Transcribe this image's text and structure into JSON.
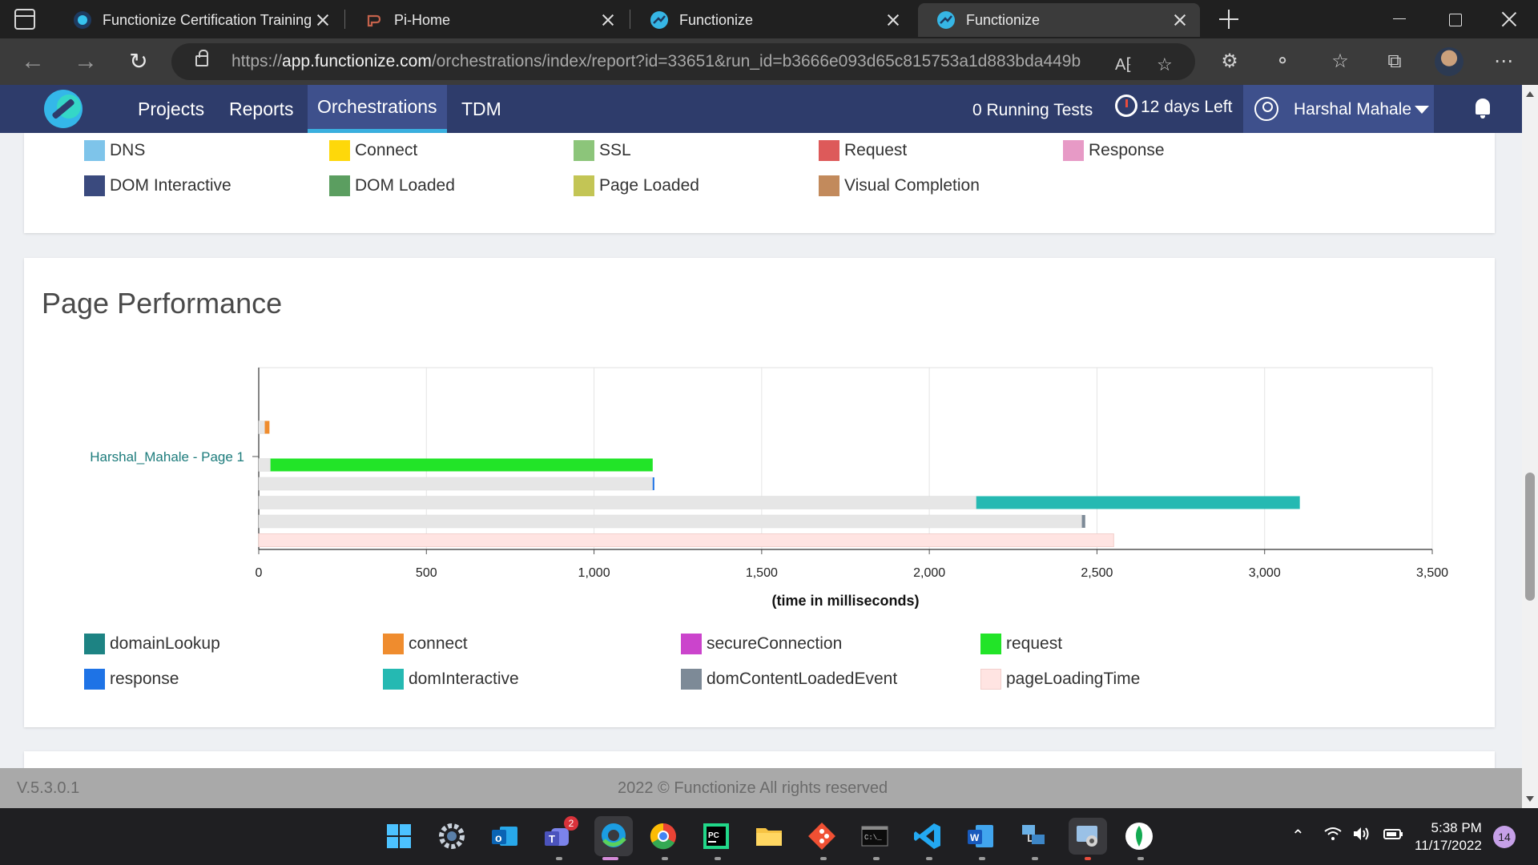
{
  "browser": {
    "tabs": [
      {
        "title": "Functionize Certification Training",
        "favicon": "functionize-icon",
        "active": false
      },
      {
        "title": "Pi-Home",
        "favicon": "pi-home-icon",
        "active": false
      },
      {
        "title": "Functionize",
        "favicon": "functionize-icon",
        "active": false
      },
      {
        "title": "Functionize",
        "favicon": "functionize-icon",
        "active": true
      }
    ],
    "url_prefix": "https://",
    "url_domain": "app.functionize.com",
    "url_path": "/orchestrations/index/report?id=33651&run_id=b3666e093d65c815753a1d883bda449b"
  },
  "app_header": {
    "nav": [
      "Projects",
      "Reports",
      "Orchestrations",
      "TDM"
    ],
    "active_nav": "Orchestrations",
    "running_tests": "0 Running Tests",
    "days_left": "12 days Left",
    "user_name": "Harshal Mahale",
    "colors": {
      "header_bg": "#2e3c6b",
      "active_tab_bg": "#3e508c",
      "active_underline": "#3ab0e0"
    }
  },
  "timing_legend": {
    "items": [
      {
        "label": "DNS",
        "color": "#7ec4ea"
      },
      {
        "label": "Connect",
        "color": "#fed80a"
      },
      {
        "label": "SSL",
        "color": "#8cc57a"
      },
      {
        "label": "Request",
        "color": "#dd5a5a"
      },
      {
        "label": "Response",
        "color": "#e79ac6"
      },
      {
        "label": "DOM Interactive",
        "color": "#3a4a7e"
      },
      {
        "label": "DOM Loaded",
        "color": "#5b9e60"
      },
      {
        "label": "Page Loaded",
        "color": "#c3c555"
      },
      {
        "label": "Visual Completion",
        "color": "#c28a5c"
      }
    ]
  },
  "page_performance": {
    "title": "Page Performance",
    "legend": [
      {
        "label": "domainLookup",
        "color": "#1d8383"
      },
      {
        "label": "connect",
        "color": "#ef8c2e"
      },
      {
        "label": "secureConnection",
        "color": "#cb44cc"
      },
      {
        "label": "request",
        "color": "#22e428"
      },
      {
        "label": "response",
        "color": "#1e73e6"
      },
      {
        "label": "domInteractive",
        "color": "#25b9b2"
      },
      {
        "label": "domContentLoadedEvent",
        "color": "#7d8a97"
      },
      {
        "label": "pageLoadingTime",
        "color": "#ffe4e2"
      }
    ]
  },
  "chart_data": {
    "type": "bar",
    "orientation": "horizontal",
    "stacked_offset": true,
    "category": "Harshal_Mahale - Page 1",
    "xlabel": "(time in milliseconds)",
    "xlim": [
      0,
      3500
    ],
    "xticks": [
      0,
      500,
      1000,
      1500,
      2000,
      2500,
      3000,
      3500
    ],
    "xtick_labels": [
      "0",
      "500",
      "1,000",
      "1,500",
      "2,000",
      "2,500",
      "3,000",
      "3,500"
    ],
    "grid": true,
    "series": [
      {
        "name": "domainLookup",
        "start": 0,
        "end": 0
      },
      {
        "name": "connect",
        "start": 18,
        "end": 32
      },
      {
        "name": "secureConnection",
        "start": 0,
        "end": 0
      },
      {
        "name": "request",
        "start": 35,
        "end": 1175
      },
      {
        "name": "response",
        "start": 1175,
        "end": 1177
      },
      {
        "name": "domInteractive",
        "start": 2140,
        "end": 3105
      },
      {
        "name": "domContentLoadedEvent",
        "start": 2455,
        "end": 2465
      },
      {
        "name": "pageLoadingTime",
        "start": 0,
        "end": 2550
      }
    ]
  },
  "footer": {
    "version": "V.5.3.0.1",
    "copyright": "2022 © Functionize All rights reserved"
  },
  "taskbar": {
    "time": "5:38 PM",
    "date": "11/17/2022",
    "notification_count": "14",
    "teams_badge": "2",
    "apps": [
      "windows-start-icon",
      "settings-icon",
      "outlook-icon",
      "teams-icon",
      "edge-icon",
      "chrome-icon",
      "pycharm-icon",
      "file-explorer-icon",
      "git-icon",
      "terminal-icon",
      "vscode-icon",
      "word-icon",
      "network-icon",
      "camera-app-icon",
      "mongodb-icon"
    ]
  }
}
